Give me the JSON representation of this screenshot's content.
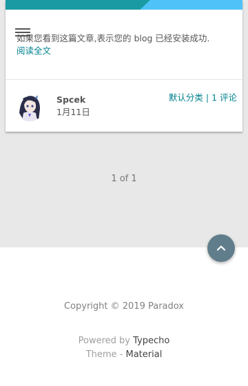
{
  "post": {
    "excerpt": "如果您看到这篇文章,表示您的 blog 已经安装成功.",
    "read_more": "阅读全文",
    "author": "Spcek",
    "date": "1月11日",
    "category": "默认分类",
    "separator": "|",
    "comments": "1 评论"
  },
  "pagination": {
    "label": "1 of 1"
  },
  "footer": {
    "copyright": "Copyright © 2019 Paradox",
    "powered_prefix": "Powered by",
    "powered_link": "Typecho",
    "theme_prefix": "Theme -",
    "theme_link": "Material"
  },
  "icons": {
    "menu": "menu-icon",
    "back_to_top": "chevron-up-icon",
    "avatar": "avatar"
  },
  "colors": {
    "header_light": "#4fc3f7",
    "header_dark": "#1a9ba3",
    "link": "#00838f",
    "fab": "#607d8b",
    "background": "#e8e8e8"
  }
}
